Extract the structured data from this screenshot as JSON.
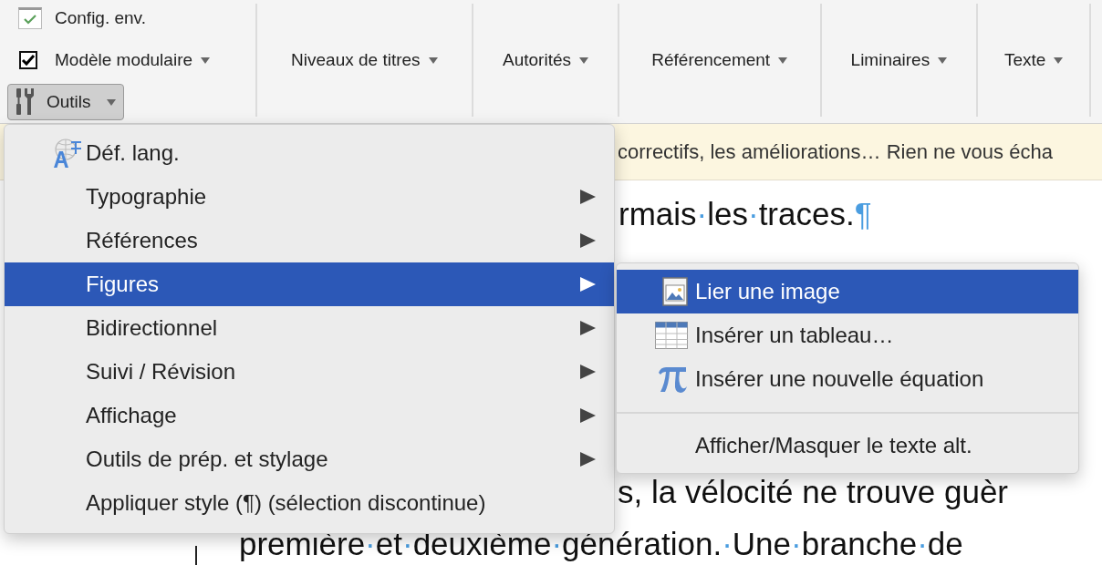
{
  "toolbar": {
    "left_group": [
      {
        "kind": "check-button",
        "label": "Config. env.",
        "checked": true
      },
      {
        "kind": "checkbox",
        "label": "Modèle modulaire",
        "checked": true,
        "dropdown": true
      },
      {
        "kind": "tool-button",
        "label": "Outils",
        "pressed": true,
        "dropdown": true
      }
    ],
    "groups": [
      {
        "label": "Niveaux de titres"
      },
      {
        "label": "Autorités"
      },
      {
        "label": "Référencement"
      },
      {
        "label": "Liminaires"
      },
      {
        "label": "Texte"
      }
    ]
  },
  "info_bar": {
    "text": "correctifs, les améliorations… Rien ne vous écha"
  },
  "document": {
    "lines": [
      {
        "words": [
          "rmais",
          "les",
          "traces."
        ],
        "pilcrow": "¶"
      },
      {
        "words": [
          "s, la vélocité ne trouve guèr"
        ]
      },
      {
        "words": [
          "première",
          "et",
          "deuxième",
          "génération.",
          "Une",
          "branche",
          "de"
        ]
      }
    ],
    "space_mark": "·"
  },
  "menu": {
    "items": [
      {
        "kind": "language",
        "label": "Déf. lang.",
        "selected": false,
        "submenu": false
      },
      {
        "kind": "plain",
        "label": "Typographie",
        "selected": false,
        "submenu": true
      },
      {
        "kind": "plain",
        "label": "Références",
        "selected": false,
        "submenu": true
      },
      {
        "kind": "plain",
        "label": "Figures",
        "selected": true,
        "submenu": true
      },
      {
        "kind": "plain",
        "label": "Bidirectionnel",
        "selected": false,
        "submenu": true
      },
      {
        "kind": "plain",
        "label": "Suivi / Révision",
        "selected": false,
        "submenu": true
      },
      {
        "kind": "plain",
        "label": "Affichage",
        "selected": false,
        "submenu": true
      },
      {
        "kind": "plain",
        "label": "Outils de prép. et stylage",
        "selected": false,
        "submenu": true
      },
      {
        "kind": "plain",
        "label": "Appliquer style (¶) (sélection discontinue)",
        "selected": false,
        "submenu": false
      }
    ]
  },
  "submenu": {
    "items": [
      {
        "kind": "image",
        "label": "Lier une image",
        "selected": true
      },
      {
        "kind": "table",
        "label": "Insérer un tableau…",
        "selected": false
      },
      {
        "kind": "equation",
        "label": "Insérer une nouvelle équation",
        "selected": false
      },
      {
        "kind": "separator"
      },
      {
        "kind": "plain",
        "label": "Afficher/Masquer le texte alt.",
        "selected": false
      }
    ]
  }
}
